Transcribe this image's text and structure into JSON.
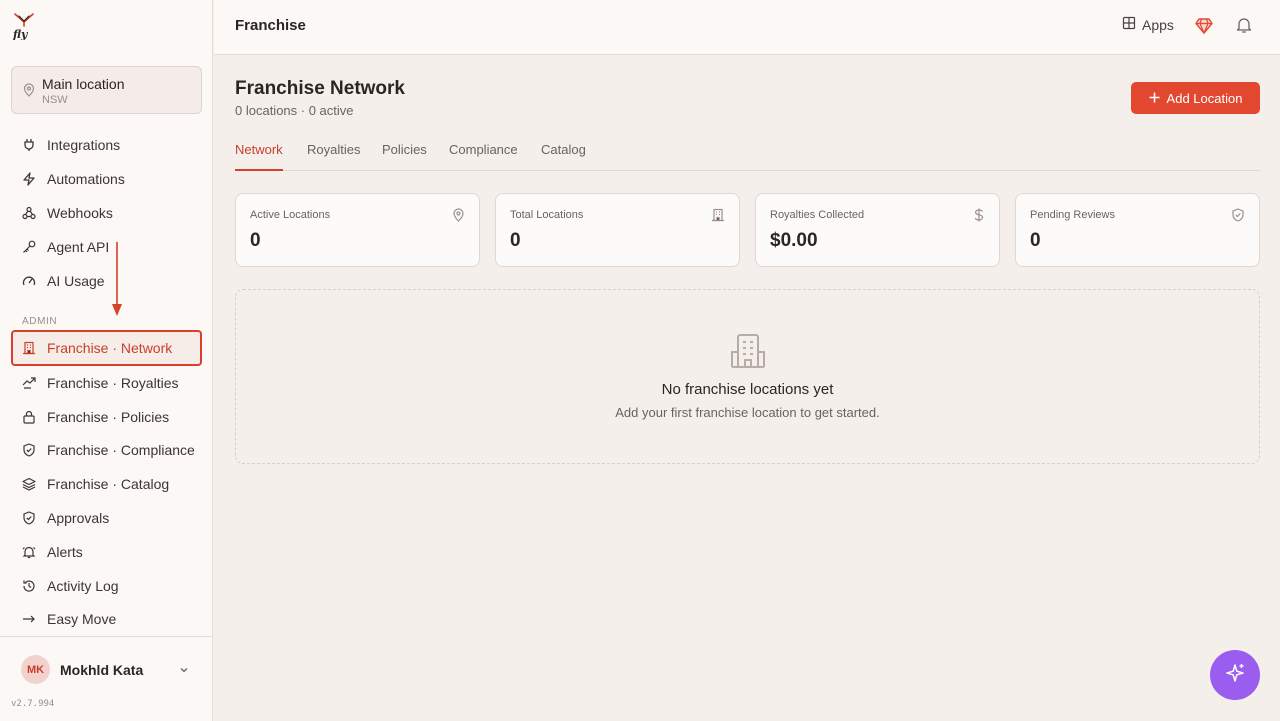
{
  "brand": {
    "logo_text": "fly",
    "accent": "#e2482f",
    "active_border": "#d7402b",
    "fab_color": "#9b5cf0"
  },
  "location": {
    "name": "Main location",
    "region": "NSW"
  },
  "sidebar": {
    "items": [
      {
        "label": "Integrations",
        "icon": "plug-icon"
      },
      {
        "label": "Automations",
        "icon": "lightning-icon"
      },
      {
        "label": "Webhooks",
        "icon": "webhook-icon"
      },
      {
        "label": "Agent API",
        "icon": "key-icon"
      },
      {
        "label": "AI Usage",
        "icon": "gauge-icon"
      }
    ],
    "admin_label": "ADMIN",
    "admin_items": [
      {
        "label": "Franchise · Network",
        "icon": "building-icon",
        "active": true
      },
      {
        "label": "Franchise · Royalties",
        "icon": "coins-icon"
      },
      {
        "label": "Franchise · Policies",
        "icon": "lock-icon"
      },
      {
        "label": "Franchise · Compliance",
        "icon": "shield-check-icon"
      },
      {
        "label": "Franchise · Catalog",
        "icon": "layers-icon"
      },
      {
        "label": "Approvals",
        "icon": "shield-check-icon"
      },
      {
        "label": "Alerts",
        "icon": "bell-ring-icon"
      },
      {
        "label": "Activity Log",
        "icon": "history-icon"
      },
      {
        "label": "Easy Move",
        "icon": "arrow-right-icon"
      }
    ]
  },
  "user": {
    "initials": "MK",
    "name": "Mokhld Kata",
    "version": "v2.7.994"
  },
  "header": {
    "title": "Franchise",
    "apps_label": "Apps"
  },
  "main": {
    "title": "Franchise Network",
    "subtitle": "0 locations · 0 active",
    "add_button": "Add Location",
    "tabs": [
      "Network",
      "Royalties",
      "Policies",
      "Compliance",
      "Catalog"
    ],
    "active_tab": "Network",
    "stats": [
      {
        "label": "Active Locations",
        "value": "0",
        "icon": "map-pin-icon"
      },
      {
        "label": "Total Locations",
        "value": "0",
        "icon": "building-icon"
      },
      {
        "label": "Royalties Collected",
        "value": "$0.00",
        "icon": "dollar-icon"
      },
      {
        "label": "Pending Reviews",
        "value": "0",
        "icon": "shield-check-icon"
      }
    ],
    "empty_title": "No franchise locations yet",
    "empty_subtitle": "Add your first franchise location to get started."
  }
}
